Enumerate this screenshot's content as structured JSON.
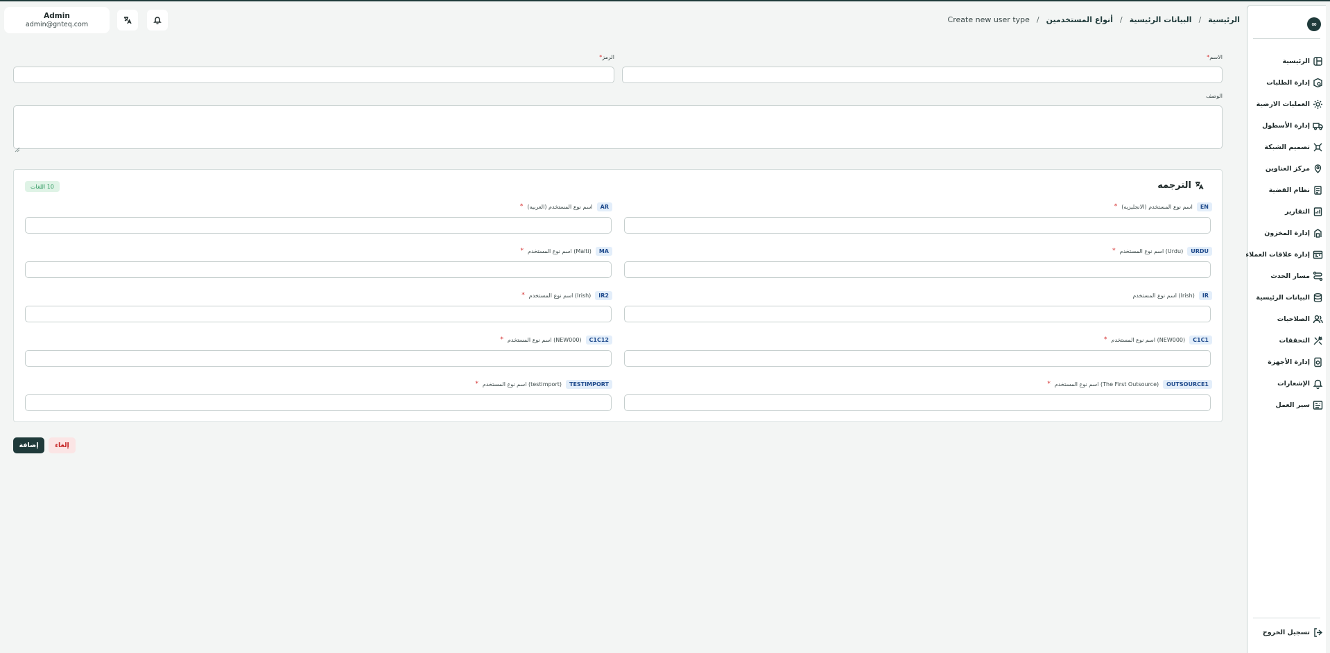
{
  "header": {
    "user": {
      "name": "Admin",
      "email": "admin@gnteq.com"
    },
    "translate_icon": "translate-icon",
    "bell_icon": "bell-icon",
    "breadcrumb": [
      "الرئيسية",
      "البيانات الرئيسية",
      "أنواع المستخدمين",
      "Create new user type"
    ],
    "separator": "/"
  },
  "sidebar": {
    "logo": "∞",
    "items": [
      {
        "label": "الرئيسية",
        "icon": "layout-icon"
      },
      {
        "label": "إدارة الطلبات",
        "icon": "box-icon"
      },
      {
        "label": "العمليات الارضية",
        "icon": "sun-icon"
      },
      {
        "label": "إدارة الأسطول",
        "icon": "truck-icon"
      },
      {
        "label": "تصميم الشبكة",
        "icon": "network-icon"
      },
      {
        "label": "مركز العناوين",
        "icon": "location-icon"
      },
      {
        "label": "نظام القضية",
        "icon": "case-icon"
      },
      {
        "label": "التقارير",
        "icon": "report-icon"
      },
      {
        "label": "إدارة المخزون",
        "icon": "warehouse-icon"
      },
      {
        "label": "إدارة علاقات العملاء",
        "icon": "crm-icon"
      },
      {
        "label": "مسار الحدث",
        "icon": "route-icon"
      },
      {
        "label": "البيانات الرئيسية",
        "icon": "database-icon"
      },
      {
        "label": "الصلاحيات",
        "icon": "users-icon"
      },
      {
        "label": "التحققات",
        "icon": "tools-icon"
      },
      {
        "label": "إدارة الأجهزة",
        "icon": "device-icon"
      },
      {
        "label": "الإشعارات",
        "icon": "bell-icon"
      },
      {
        "label": "سير العمل",
        "icon": "workflow-icon"
      }
    ],
    "logout": "تسجيل الخروج"
  },
  "form": {
    "name_label": "الاسم",
    "code_label": "الرمز",
    "description_label": "الوصف",
    "required_mark": "*",
    "name_value": "",
    "code_value": "",
    "description_value": ""
  },
  "translation": {
    "title": "الترجمه",
    "count_badge": "10 اللغات",
    "fields": [
      {
        "code": "EN",
        "label": "اسم نوع المستخدم (الانجليزيه)",
        "required": true,
        "value": ""
      },
      {
        "code": "AR",
        "label": "اسم نوع المستخدم (العربيه)",
        "required": true,
        "value": ""
      },
      {
        "code": "URDU",
        "label": "اسم نوع المستخدم (Urdu)",
        "required": true,
        "value": ""
      },
      {
        "code": "MA",
        "label": "اسم نوع المستخدم (Malti)",
        "required": true,
        "value": ""
      },
      {
        "code": "IR",
        "label": "اسم نوع المستخدم (Irish)",
        "required": false,
        "value": ""
      },
      {
        "code": "IR2",
        "label": "اسم نوع المستخدم (Irish)",
        "required": true,
        "value": ""
      },
      {
        "code": "C1C1",
        "label": "اسم نوع المستخدم (NEW000)",
        "required": true,
        "value": ""
      },
      {
        "code": "C1C12",
        "label": "اسم نوع المستخدم (NEW000)",
        "required": true,
        "value": ""
      },
      {
        "code": "OUTSOURCE1",
        "label": "اسم نوع المستخدم (The First Outsource)",
        "required": true,
        "value": ""
      },
      {
        "code": "TESTIMPORT",
        "label": "اسم نوع المستخدم (testimport)",
        "required": true,
        "value": ""
      }
    ]
  },
  "actions": {
    "add": "إضافة",
    "cancel": "إلغاء"
  },
  "colors": {
    "brand": "#1f3a3a",
    "required": "#d42a2a",
    "cancel_bg": "#fbe5e5",
    "badge_bg": "#e3eefa",
    "count_bg": "#dff3e6"
  }
}
